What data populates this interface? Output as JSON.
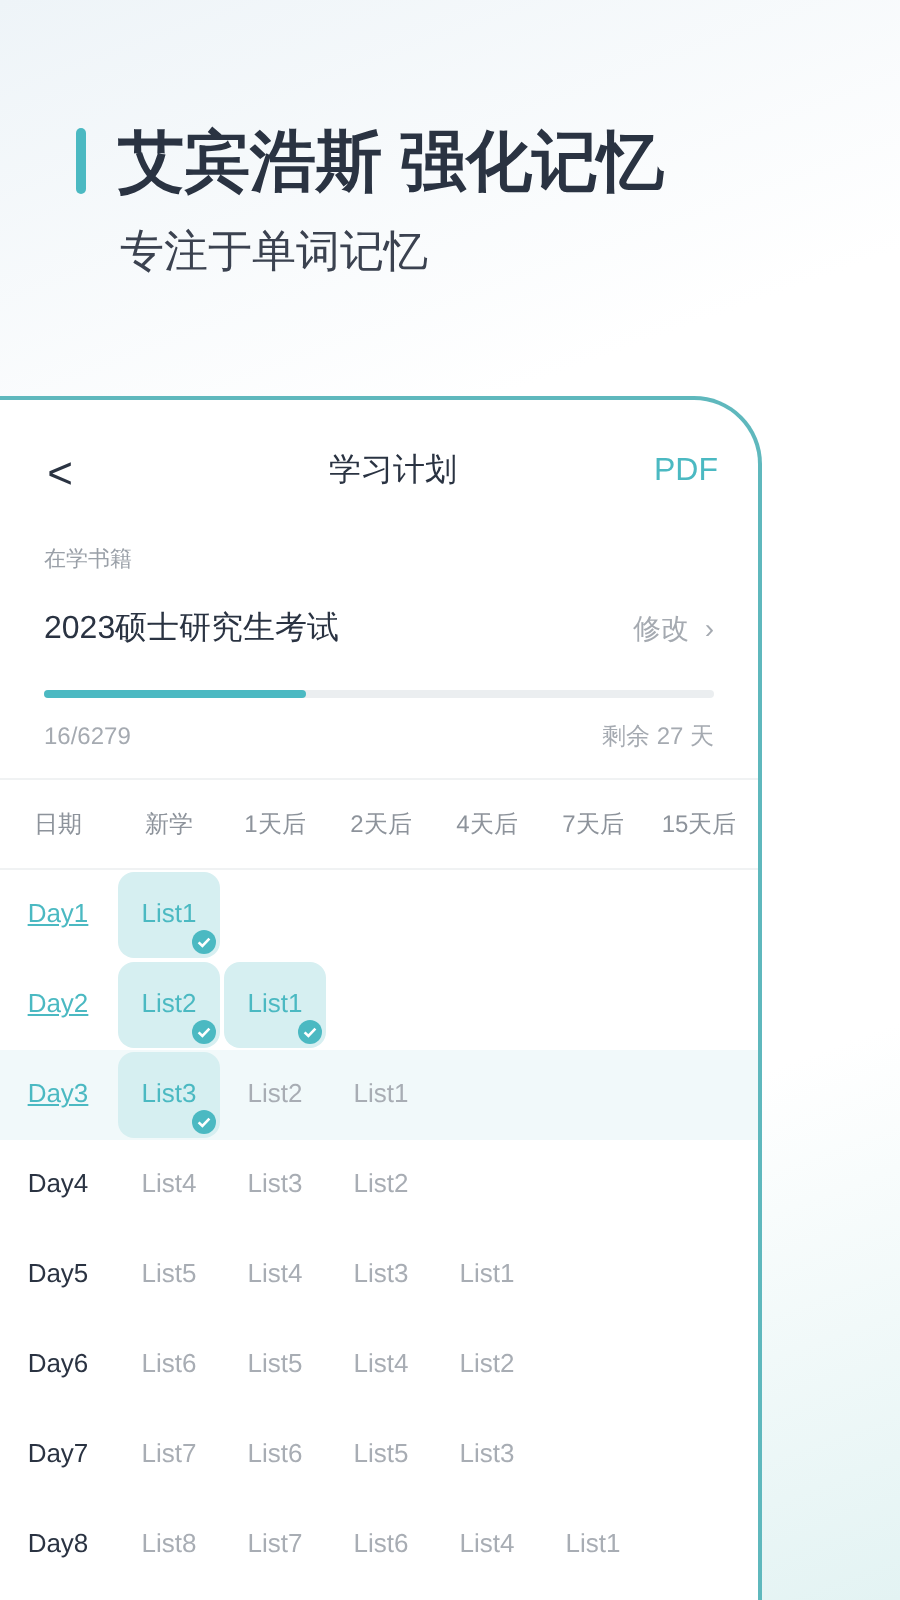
{
  "headline": {
    "title": "艾宾浩斯 强化记忆",
    "subtitle": "专注于单词记忆"
  },
  "nav": {
    "back": "<",
    "title": "学习计划",
    "action": "PDF"
  },
  "book": {
    "label": "在学书籍",
    "name": "2023硕士研究生考试",
    "edit": "修改",
    "edit_arrow": "›",
    "level": 0.39,
    "count": "16/6279",
    "remaining": "剩余 27 天"
  },
  "table": {
    "columns": [
      "日期",
      "新学",
      "1天后",
      "2天后",
      "4天后",
      "7天后",
      "15天后"
    ],
    "rows": [
      {
        "selected": false,
        "cells": [
          {
            "kind": "day",
            "label": "Day1",
            "linked": true
          },
          {
            "kind": "list",
            "label": "List1",
            "done": true
          }
        ]
      },
      {
        "selected": false,
        "cells": [
          {
            "kind": "day",
            "label": "Day2",
            "linked": true
          },
          {
            "kind": "list",
            "label": "List2",
            "done": true
          },
          {
            "kind": "list",
            "label": "List1",
            "done": true
          }
        ]
      },
      {
        "selected": true,
        "cells": [
          {
            "kind": "day",
            "label": "Day3",
            "linked": true
          },
          {
            "kind": "list",
            "label": "List3",
            "done": true
          },
          {
            "kind": "list",
            "label": "List2",
            "done": false
          },
          {
            "kind": "list",
            "label": "List1",
            "done": false
          }
        ]
      },
      {
        "selected": false,
        "cells": [
          {
            "kind": "day",
            "label": "Day4",
            "linked": false
          },
          {
            "kind": "list",
            "label": "List4",
            "done": false
          },
          {
            "kind": "list",
            "label": "List3",
            "done": false
          },
          {
            "kind": "list",
            "label": "List2",
            "done": false
          }
        ]
      },
      {
        "selected": false,
        "cells": [
          {
            "kind": "day",
            "label": "Day5",
            "linked": false
          },
          {
            "kind": "list",
            "label": "List5",
            "done": false
          },
          {
            "kind": "list",
            "label": "List4",
            "done": false
          },
          {
            "kind": "list",
            "label": "List3",
            "done": false
          },
          {
            "kind": "list",
            "label": "List1",
            "done": false
          }
        ]
      },
      {
        "selected": false,
        "cells": [
          {
            "kind": "day",
            "label": "Day6",
            "linked": false
          },
          {
            "kind": "list",
            "label": "List6",
            "done": false
          },
          {
            "kind": "list",
            "label": "List5",
            "done": false
          },
          {
            "kind": "list",
            "label": "List4",
            "done": false
          },
          {
            "kind": "list",
            "label": "List2",
            "done": false
          }
        ]
      },
      {
        "selected": false,
        "cells": [
          {
            "kind": "day",
            "label": "Day7",
            "linked": false
          },
          {
            "kind": "list",
            "label": "List7",
            "done": false
          },
          {
            "kind": "list",
            "label": "List6",
            "done": false
          },
          {
            "kind": "list",
            "label": "List5",
            "done": false
          },
          {
            "kind": "list",
            "label": "List3",
            "done": false
          }
        ]
      },
      {
        "selected": false,
        "cells": [
          {
            "kind": "day",
            "label": "Day8",
            "linked": false
          },
          {
            "kind": "list",
            "label": "List8",
            "done": false
          },
          {
            "kind": "list",
            "label": "List7",
            "done": false
          },
          {
            "kind": "list",
            "label": "List6",
            "done": false
          },
          {
            "kind": "list",
            "label": "List4",
            "done": false
          },
          {
            "kind": "list",
            "label": "List1",
            "done": false
          }
        ]
      }
    ]
  }
}
